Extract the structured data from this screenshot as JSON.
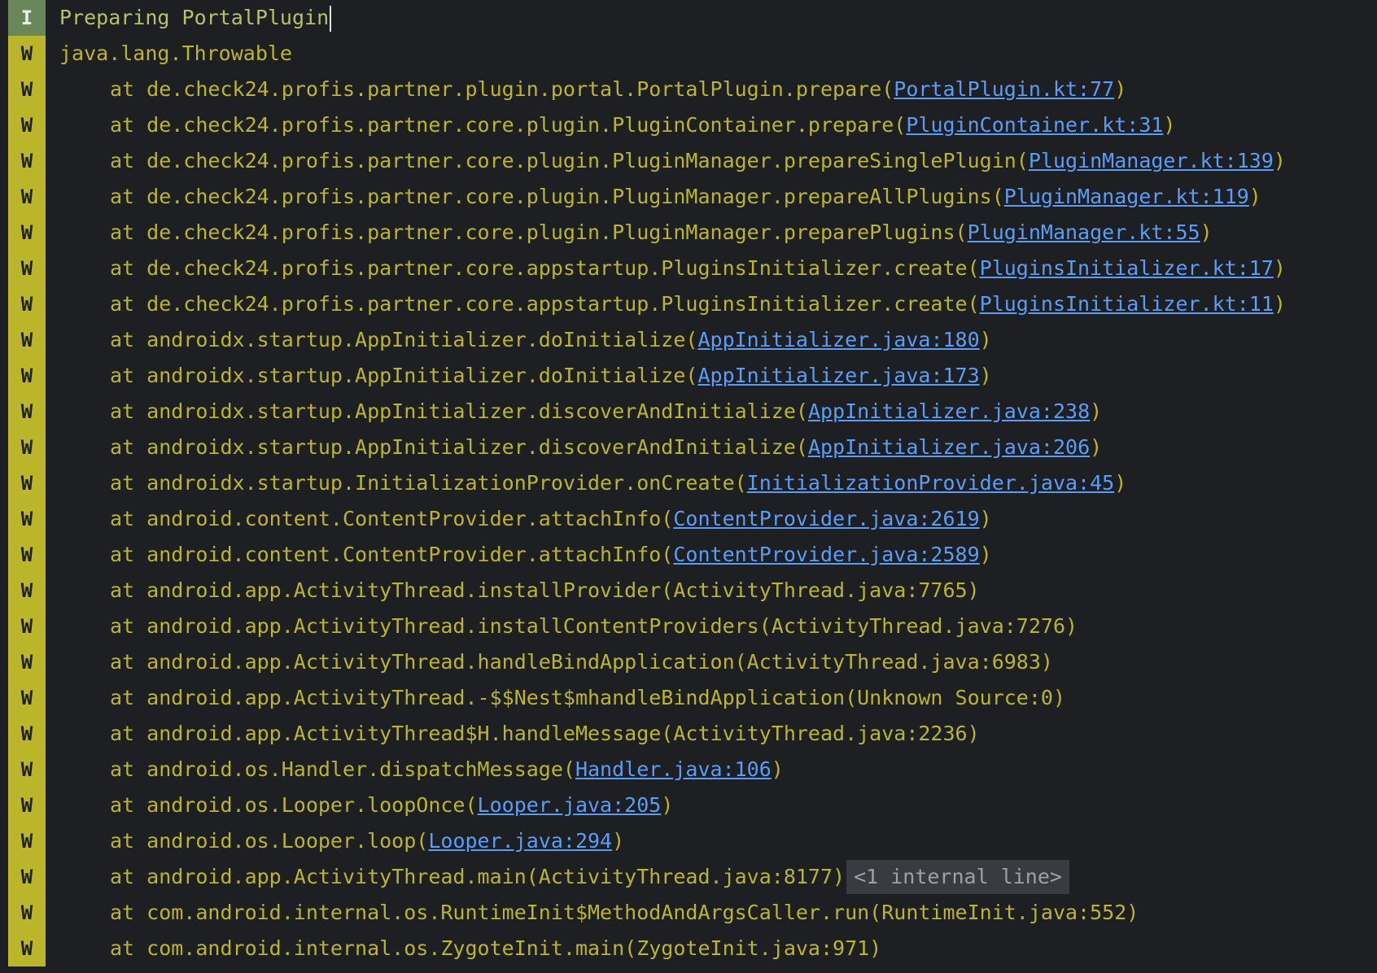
{
  "log": {
    "lines": [
      {
        "level": "I",
        "text": "Preparing PortalPlugin",
        "cursor": true
      },
      {
        "level": "W",
        "text": "java.lang.Throwable"
      },
      {
        "level": "W",
        "indent": true,
        "pre": "at de.check24.profis.partner.plugin.portal.PortalPlugin.prepare(",
        "link": "PortalPlugin.kt:77",
        "post": ")"
      },
      {
        "level": "W",
        "indent": true,
        "pre": "at de.check24.profis.partner.core.plugin.PluginContainer.prepare(",
        "link": "PluginContainer.kt:31",
        "post": ")"
      },
      {
        "level": "W",
        "indent": true,
        "pre": "at de.check24.profis.partner.core.plugin.PluginManager.prepareSinglePlugin(",
        "link": "PluginManager.kt:139",
        "post": ")"
      },
      {
        "level": "W",
        "indent": true,
        "pre": "at de.check24.profis.partner.core.plugin.PluginManager.prepareAllPlugins(",
        "link": "PluginManager.kt:119",
        "post": ")"
      },
      {
        "level": "W",
        "indent": true,
        "pre": "at de.check24.profis.partner.core.plugin.PluginManager.preparePlugins(",
        "link": "PluginManager.kt:55",
        "post": ")"
      },
      {
        "level": "W",
        "indent": true,
        "pre": "at de.check24.profis.partner.core.appstartup.PluginsInitializer.create(",
        "link": "PluginsInitializer.kt:17",
        "post": ")"
      },
      {
        "level": "W",
        "indent": true,
        "pre": "at de.check24.profis.partner.core.appstartup.PluginsInitializer.create(",
        "link": "PluginsInitializer.kt:11",
        "post": ")"
      },
      {
        "level": "W",
        "indent": true,
        "pre": "at androidx.startup.AppInitializer.doInitialize(",
        "link": "AppInitializer.java:180",
        "post": ")"
      },
      {
        "level": "W",
        "indent": true,
        "pre": "at androidx.startup.AppInitializer.doInitialize(",
        "link": "AppInitializer.java:173",
        "post": ")"
      },
      {
        "level": "W",
        "indent": true,
        "pre": "at androidx.startup.AppInitializer.discoverAndInitialize(",
        "link": "AppInitializer.java:238",
        "post": ")"
      },
      {
        "level": "W",
        "indent": true,
        "pre": "at androidx.startup.AppInitializer.discoverAndInitialize(",
        "link": "AppInitializer.java:206",
        "post": ")"
      },
      {
        "level": "W",
        "indent": true,
        "pre": "at androidx.startup.InitializationProvider.onCreate(",
        "link": "InitializationProvider.java:45",
        "post": ")"
      },
      {
        "level": "W",
        "indent": true,
        "pre": "at android.content.ContentProvider.attachInfo(",
        "link": "ContentProvider.java:2619",
        "post": ")"
      },
      {
        "level": "W",
        "indent": true,
        "pre": "at android.content.ContentProvider.attachInfo(",
        "link": "ContentProvider.java:2589",
        "post": ")"
      },
      {
        "level": "W",
        "indent": true,
        "pre": "at android.app.ActivityThread.installProvider(ActivityThread.java:7765)"
      },
      {
        "level": "W",
        "indent": true,
        "pre": "at android.app.ActivityThread.installContentProviders(ActivityThread.java:7276)"
      },
      {
        "level": "W",
        "indent": true,
        "pre": "at android.app.ActivityThread.handleBindApplication(ActivityThread.java:6983)"
      },
      {
        "level": "W",
        "indent": true,
        "pre": "at android.app.ActivityThread.-$$Nest$mhandleBindApplication(Unknown Source:0)"
      },
      {
        "level": "W",
        "indent": true,
        "pre": "at android.app.ActivityThread$H.handleMessage(ActivityThread.java:2236)"
      },
      {
        "level": "W",
        "indent": true,
        "pre": "at android.os.Handler.dispatchMessage(",
        "link": "Handler.java:106",
        "post": ")"
      },
      {
        "level": "W",
        "indent": true,
        "pre": "at android.os.Looper.loopOnce(",
        "link": "Looper.java:205",
        "post": ")"
      },
      {
        "level": "W",
        "indent": true,
        "pre": "at android.os.Looper.loop(",
        "link": "Looper.java:294",
        "post": ")"
      },
      {
        "level": "W",
        "indent": true,
        "pre": "at android.app.ActivityThread.main(ActivityThread.java:8177)",
        "folded": "<1 internal line>"
      },
      {
        "level": "W",
        "indent": true,
        "pre": "at com.android.internal.os.RuntimeInit$MethodAndArgsCaller.run(RuntimeInit.java:552)"
      },
      {
        "level": "W",
        "indent": true,
        "pre": "at com.android.internal.os.ZygoteInit.main(ZygoteInit.java:971)"
      }
    ]
  },
  "colors": {
    "background": "#1e1f22",
    "info_badge": "#6a8759",
    "warn_badge": "#bbb529",
    "warn_text": "#bbb529",
    "link": "#5a9df4",
    "folded_bg": "#393b40"
  }
}
